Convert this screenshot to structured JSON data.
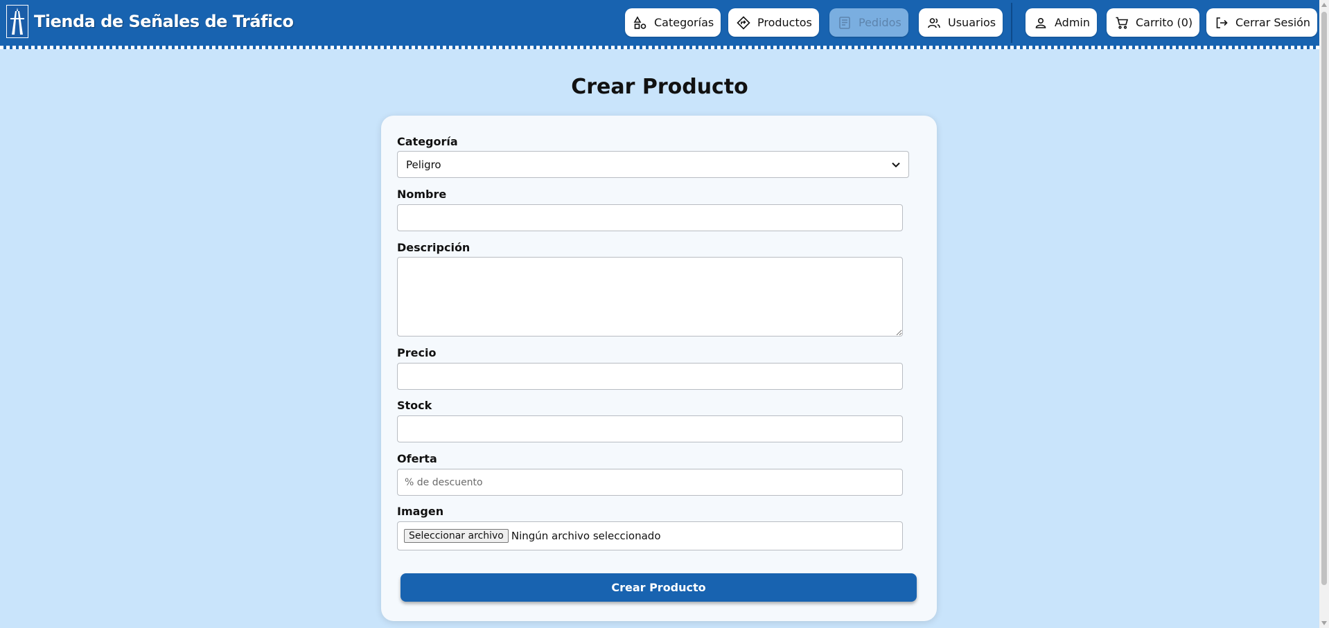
{
  "header": {
    "brand": "Tienda de Señales de Tráfico",
    "nav": [
      {
        "label": "Categorías",
        "icon": "shapes-icon"
      },
      {
        "label": "Productos",
        "icon": "diamond-sign-icon"
      },
      {
        "label": "Pedidos",
        "icon": "receipt-icon",
        "disabled": true
      },
      {
        "label": "Usuarios",
        "icon": "users-icon"
      }
    ],
    "user": {
      "label": "Admin",
      "icon": "user-icon"
    },
    "cart": {
      "label": "Carrito (0)",
      "icon": "cart-icon"
    },
    "logout": {
      "label": "Cerrar Sesión",
      "icon": "logout-icon"
    }
  },
  "page": {
    "title": "Crear Producto"
  },
  "form": {
    "categoria": {
      "label": "Categoría",
      "value": "Peligro"
    },
    "nombre": {
      "label": "Nombre",
      "value": ""
    },
    "descripcion": {
      "label": "Descripción",
      "value": ""
    },
    "precio": {
      "label": "Precio",
      "value": ""
    },
    "stock": {
      "label": "Stock",
      "value": ""
    },
    "oferta": {
      "label": "Oferta",
      "placeholder": "% de descuento",
      "value": ""
    },
    "imagen": {
      "label": "Imagen",
      "button": "Seleccionar archivo",
      "status": "Ningún archivo seleccionado"
    },
    "submit": "Crear Producto"
  },
  "colors": {
    "header": "#1863b0",
    "background": "#c9e4fb",
    "primary_button": "#1863b0"
  }
}
